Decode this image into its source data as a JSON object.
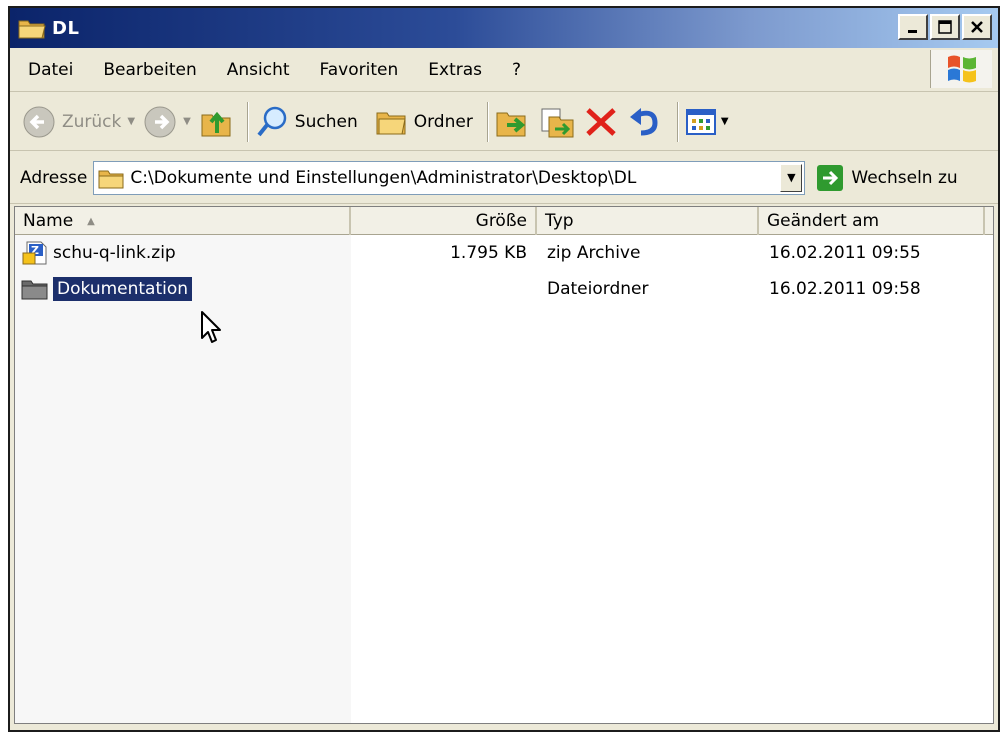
{
  "window": {
    "title": "DL"
  },
  "menu": [
    "Datei",
    "Bearbeiten",
    "Ansicht",
    "Favoriten",
    "Extras",
    "?"
  ],
  "toolbar": {
    "back_label": "Zurück",
    "search_label": "Suchen",
    "folders_label": "Ordner"
  },
  "address": {
    "label": "Adresse",
    "path": "C:\\Dokumente und Einstellungen\\Administrator\\Desktop\\DL",
    "go_label": "Wechseln zu"
  },
  "columns": {
    "name": "Name",
    "size": "Größe",
    "type": "Typ",
    "date": "Geändert am"
  },
  "files": [
    {
      "name": "schu-q-link.zip",
      "size": "1.795 KB",
      "type": "zip Archive",
      "date": "16.02.2011 09:55",
      "icon": "zip-file-icon",
      "selected": false
    },
    {
      "name": "Dokumentation",
      "size": "",
      "type": "Dateiordner",
      "date": "16.02.2011 09:58",
      "icon": "folder-icon",
      "selected": true
    }
  ],
  "colors": {
    "titlebar_start": "#0b246a",
    "selection": "#1c2f6b",
    "chrome": "#ece9d8"
  }
}
